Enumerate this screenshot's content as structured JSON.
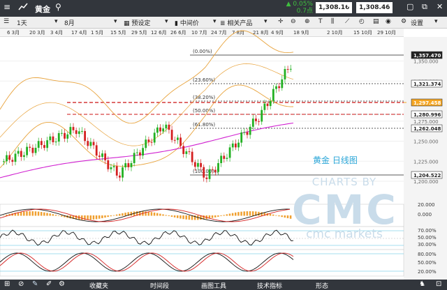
{
  "topbar": {
    "title": "黄金",
    "change_pct": "0.05%",
    "change_pts": "0.7点",
    "sell_price": "1,308.16",
    "buy_price": "1,308.46"
  },
  "toolbar": {
    "period": "1天",
    "range": "8月",
    "preset": "预设定",
    "price_type": "中间价",
    "related": "相关产品",
    "settings": "设置"
  },
  "dates": [
    "6 3月",
    "20 3月",
    "3 4月",
    "17 4月",
    "1 5月",
    "15 5月",
    "29 5月",
    "12 6月",
    "26 6月",
    "10 7月",
    "24 7月",
    "7 8月",
    "21 8月",
    "4 9月",
    "18 9月",
    "2 10月",
    "15 10月",
    "29 10月"
  ],
  "chart_data": {
    "type": "candlestick",
    "title": "黄金 日线图",
    "y_ticks": [
      "1,350.000",
      "1,325.000",
      "1,275.000",
      "1,250.000",
      "1,225.000",
      "1,200.000"
    ],
    "price_labels": [
      "1,357.470",
      "1,321.374",
      "1,297.458",
      "1,280.996",
      "1,262.048",
      "1,204.522"
    ],
    "fib_levels": [
      "(0.00%)",
      "(23.60%)",
      "(38.20%)",
      "(50.00%)",
      "(61.80%)",
      "(100.00%)"
    ],
    "macd_ticks": [
      "20.000",
      "0.000"
    ],
    "rsi_ticks": [
      "70.00%",
      "50.00%",
      "30.00%"
    ],
    "stoch_ticks": [
      "80.00%",
      "50.00%",
      "20.00%"
    ],
    "colors": {
      "up": "#22b022",
      "down": "#d42020",
      "resistance": "#cc1111",
      "current": "#f5a623",
      "ma": "#d020d0",
      "band": "#e8a33c"
    }
  },
  "watermark": {
    "line1": "CHARTS BY",
    "line2": "CMC",
    "line3": "cmc markets"
  },
  "bottombar": {
    "favorites": "收藏夹",
    "timeframe": "时间段",
    "drawing": "画图工具",
    "indicators": "技术指标",
    "shapes": "形态"
  }
}
